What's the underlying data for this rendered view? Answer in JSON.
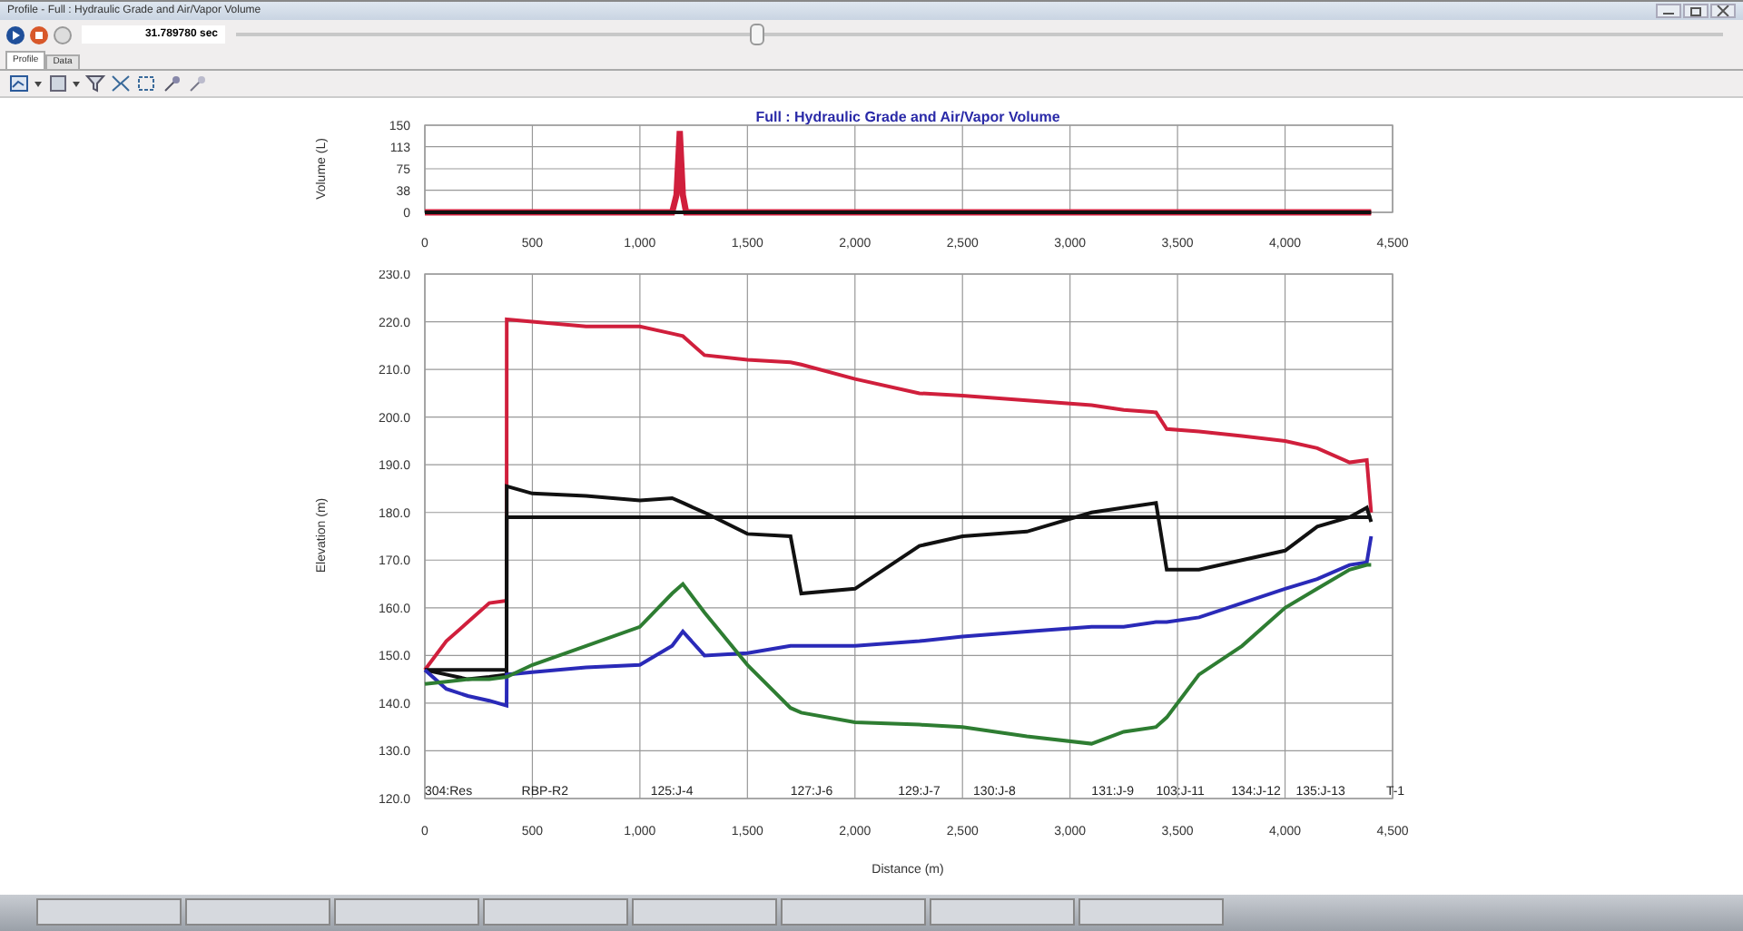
{
  "window": {
    "title": "Profile - Full : Hydraulic Grade and Air/Vapor Volume"
  },
  "playback": {
    "time": "31.789780 sec",
    "level": 0.35
  },
  "tabs": [
    {
      "label": "Profile",
      "selected": true
    },
    {
      "label": "Data",
      "selected": false
    }
  ],
  "volume_chart": {
    "chart_data": {
      "type": "line",
      "title": "Full : Hydraulic Grade and Air/Vapor Volume",
      "ylabel": "Volume (L)",
      "x": [
        0,
        1150,
        1170,
        1185,
        1200,
        1215,
        1230,
        4400
      ],
      "series": [
        {
          "color": "#d01f3c",
          "values": [
            0,
            0,
            30,
            140,
            30,
            0,
            0,
            0
          ]
        },
        {
          "color": "#111111",
          "values": [
            0,
            0,
            0,
            0,
            0,
            0,
            0,
            0
          ]
        }
      ],
      "xlim": [
        0,
        4500
      ],
      "ylim": [
        0,
        150
      ],
      "xticks": [
        0,
        500,
        {
          "value": 1000,
          "label": "1,000"
        },
        {
          "value": 1500,
          "label": "1,500"
        },
        {
          "value": 2000,
          "label": "2,000"
        },
        {
          "value": 2500,
          "label": "2,500"
        },
        {
          "value": 3000,
          "label": "3,000"
        },
        {
          "value": 3500,
          "label": "3,500"
        },
        {
          "value": 4000,
          "label": "4,000"
        },
        {
          "value": 4500,
          "label": "4,500"
        }
      ],
      "yticks": [
        0,
        38,
        75,
        113,
        150
      ],
      "grid": true
    }
  },
  "elevation_chart": {
    "chart_data": {
      "type": "line",
      "xlabel": "Distance (m)",
      "ylabel": "Elevation (m)",
      "x": [
        0,
        100,
        200,
        300,
        380,
        381,
        500,
        750,
        1000,
        1150,
        1200,
        1300,
        1500,
        1700,
        1750,
        2000,
        2300,
        2500,
        2800,
        3100,
        3250,
        3400,
        3450,
        3600,
        3800,
        4000,
        4150,
        4300,
        4380,
        4400
      ],
      "series": [
        {
          "color": "#d01f3c",
          "values": [
            147,
            153,
            157,
            161,
            161.5,
            220.5,
            220,
            219,
            219,
            217.5,
            217,
            213,
            212,
            211.5,
            211,
            208,
            205,
            204.5,
            203.5,
            202.5,
            201.5,
            201,
            197.5,
            197,
            196,
            195,
            193.5,
            190.5,
            191,
            180
          ]
        },
        {
          "color": "#111111",
          "values": [
            147,
            146,
            145,
            145.5,
            146,
            185.5,
            184,
            183.5,
            182.5,
            183,
            182,
            180,
            175.5,
            175,
            163,
            164,
            173,
            175,
            176,
            180,
            181,
            182,
            168,
            168,
            170,
            172,
            177,
            179,
            181,
            178
          ]
        },
        {
          "color": "#111111",
          "values": [
            147,
            147,
            147,
            147,
            147,
            179,
            179,
            179,
            179,
            179,
            179,
            179,
            179,
            179,
            179,
            179,
            179,
            179,
            179,
            179,
            179,
            179,
            179,
            179,
            179,
            179,
            179,
            179,
            179,
            179
          ]
        },
        {
          "color": "#2a2ab8",
          "values": [
            147,
            143,
            141.5,
            140.5,
            139.5,
            146,
            146.5,
            147.5,
            148,
            152,
            155,
            150,
            150.5,
            152,
            152,
            152,
            153,
            154,
            155,
            156,
            156,
            157,
            157,
            158,
            161,
            164,
            166,
            169,
            169.5,
            175
          ]
        },
        {
          "color": "#2e7d32",
          "values": [
            144,
            144.5,
            145,
            145,
            145.5,
            145.5,
            148,
            152,
            156,
            163,
            165,
            159,
            148,
            139,
            138,
            136,
            135.5,
            135,
            133,
            131.5,
            134,
            135,
            137,
            146,
            152,
            160,
            164,
            168,
            169,
            169
          ]
        }
      ],
      "xlim": [
        0,
        4500
      ],
      "ylim": [
        120,
        230
      ],
      "xticks": [
        0,
        500,
        {
          "value": 1000,
          "label": "1,000"
        },
        {
          "value": 1500,
          "label": "1,500"
        },
        {
          "value": 2000,
          "label": "2,000"
        },
        {
          "value": 2500,
          "label": "2,500"
        },
        {
          "value": 3000,
          "label": "3,000"
        },
        {
          "value": 3500,
          "label": "3,500"
        },
        {
          "value": 4000,
          "label": "4,000"
        },
        {
          "value": 4500,
          "label": "4,500"
        }
      ],
      "yticks": [
        {
          "value": 120,
          "label": "120.0"
        },
        {
          "value": 130,
          "label": "130.0"
        },
        {
          "value": 140,
          "label": "140.0"
        },
        {
          "value": 150,
          "label": "150.0"
        },
        {
          "value": 160,
          "label": "160.0"
        },
        {
          "value": 170,
          "label": "170.0"
        },
        {
          "value": 180,
          "label": "180.0"
        },
        {
          "value": 190,
          "label": "190.0"
        },
        {
          "value": 200,
          "label": "200.0"
        },
        {
          "value": 210,
          "label": "210.0"
        },
        {
          "value": 220,
          "label": "220.0"
        },
        {
          "value": 230,
          "label": "230.0"
        }
      ],
      "grid": true
    },
    "node_labels": [
      "304:Res",
      "RBP-R2",
      "125:J-4",
      "127:J-6",
      "129:J-7",
      "130:J-8",
      "131:J-9",
      "103:J-11",
      "134:J-12",
      "135:J-13",
      "T-1"
    ]
  }
}
